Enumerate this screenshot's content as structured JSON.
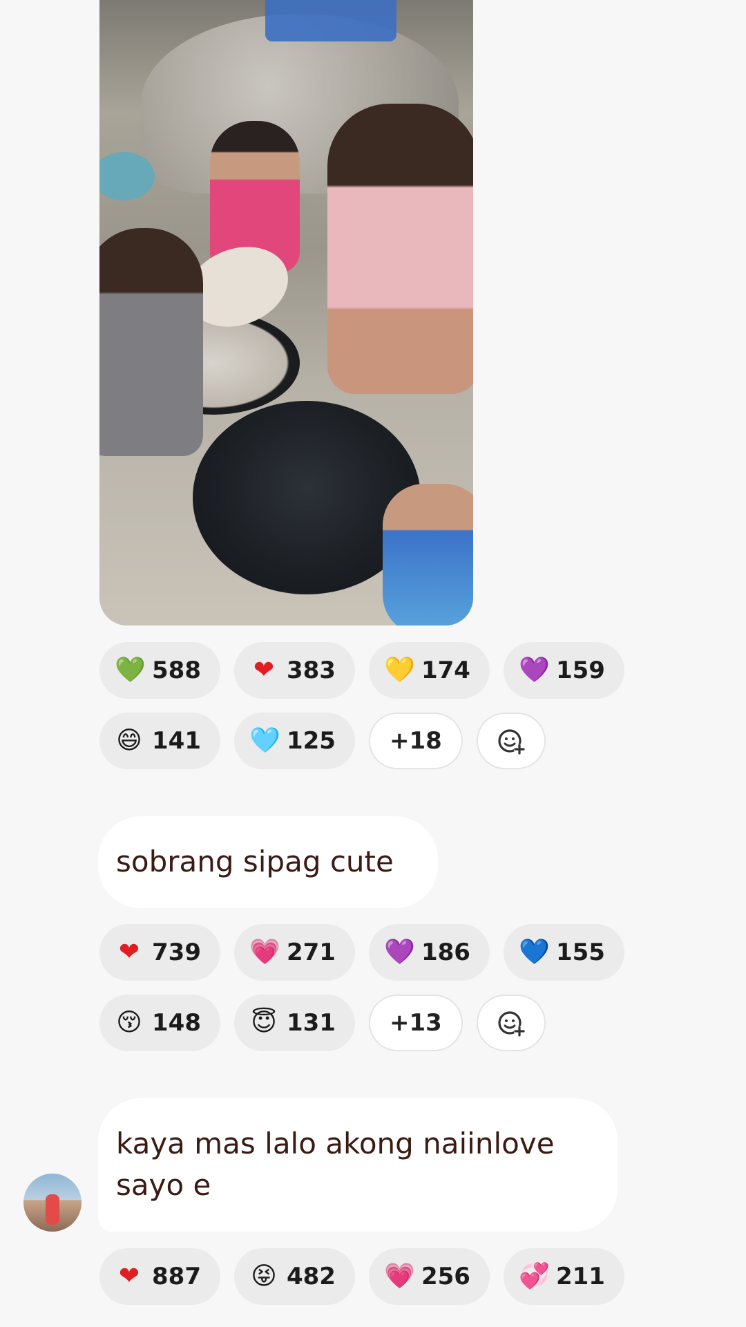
{
  "message1": {
    "reactions_row1": [
      {
        "icon": "green-heart-icon",
        "glyph": "💚",
        "color": "#6bb33a",
        "count": "588"
      },
      {
        "icon": "red-heart-icon",
        "glyph": "❤",
        "color": "#e11d21",
        "count": "383"
      },
      {
        "icon": "yellow-heart-icon",
        "glyph": "💛",
        "color": "#f2c014",
        "count": "174"
      },
      {
        "icon": "purple-heart-icon",
        "glyph": "💜",
        "color": "#8a2bc4",
        "count": "159"
      }
    ],
    "reactions_row2": [
      {
        "icon": "grinning-face-icon",
        "glyph": "😄",
        "color": "#f5b921",
        "count": "141"
      },
      {
        "icon": "light-blue-heart-icon",
        "glyph": "🩵",
        "color": "#6fc7f0",
        "count": "125"
      }
    ],
    "more_label": "+18"
  },
  "message2": {
    "text": "sobrang sipag cute",
    "reactions_row1": [
      {
        "icon": "red-heart-icon",
        "glyph": "❤",
        "color": "#e11d21",
        "count": "739"
      },
      {
        "icon": "growing-heart-icon",
        "glyph": "💗",
        "color": "#f06b8a",
        "count": "271"
      },
      {
        "icon": "purple-heart-icon",
        "glyph": "💜",
        "color": "#8a2bc4",
        "count": "186"
      },
      {
        "icon": "blue-heart-icon",
        "glyph": "💙",
        "color": "#1877f2",
        "count": "155"
      }
    ],
    "reactions_row2": [
      {
        "icon": "kissing-face-icon",
        "glyph": "😚",
        "color": "#f5b921",
        "count": "148"
      },
      {
        "icon": "smiling-face-with-halo-icon",
        "glyph": "😇",
        "color": "#f5b921",
        "count": "131"
      }
    ],
    "more_label": "+13"
  },
  "message3": {
    "text_line1": "kaya mas lalo akong naiinlove",
    "text_line2": "sayo e",
    "reactions_row1": [
      {
        "icon": "red-heart-icon",
        "glyph": "❤",
        "color": "#e11d21",
        "count": "887"
      },
      {
        "icon": "squinting-tongue-face-icon",
        "glyph": "😝",
        "color": "#f5b921",
        "count": "482"
      },
      {
        "icon": "growing-heart-icon",
        "glyph": "💗",
        "color": "#f06b8a",
        "count": "256"
      },
      {
        "icon": "hearts-icon",
        "glyph": "💞",
        "color": "#e11d21",
        "count": "211"
      }
    ]
  },
  "add_reaction_icon": "add-reaction-icon"
}
